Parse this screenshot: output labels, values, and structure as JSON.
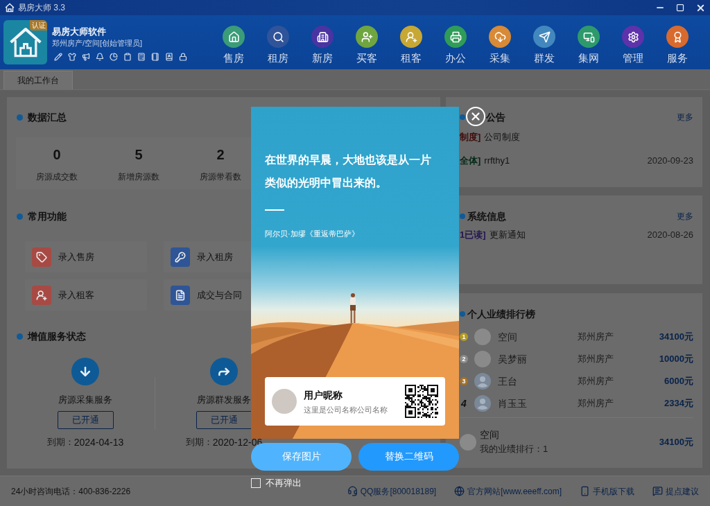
{
  "window": {
    "title": "易房大师 3.3"
  },
  "header": {
    "badge": "认证",
    "company": "易房大师软件",
    "account": "郑州房产/空间[创始管理员]",
    "nav": [
      {
        "label": "售房",
        "color": "#3a9c78"
      },
      {
        "label": "租房",
        "color": "#30549a"
      },
      {
        "label": "新房",
        "color": "#4a34a2"
      },
      {
        "label": "买客",
        "color": "#6fa640"
      },
      {
        "label": "租客",
        "color": "#c7a834"
      },
      {
        "label": "办公",
        "color": "#2f9c58"
      },
      {
        "label": "采集",
        "color": "#d88a36"
      },
      {
        "label": "群发",
        "color": "#4288be"
      },
      {
        "label": "集网",
        "color": "#2e9a6c"
      },
      {
        "label": "管理",
        "color": "#5e32aa"
      },
      {
        "label": "服务",
        "color": "#d96a2e"
      }
    ]
  },
  "tabs": [
    {
      "label": "我的工作台",
      "selected": true
    }
  ],
  "summary": {
    "title": "数据汇总",
    "stats": [
      {
        "value": "0",
        "label": "房源成交数"
      },
      {
        "value": "5",
        "label": "新增房源数"
      },
      {
        "value": "2",
        "label": "房源带看数"
      }
    ]
  },
  "shortcuts": {
    "title": "常用功能",
    "items": [
      {
        "label": "录入售房",
        "color": "#a84a44"
      },
      {
        "label": "录入租房",
        "color": "#2f5596"
      },
      {
        "label": "录入租客",
        "color": "#a84a44"
      },
      {
        "label": "成交与合同",
        "color": "#2f5596"
      }
    ]
  },
  "services": {
    "title": "增值服务状态",
    "items": [
      {
        "name": "房源采集服务",
        "status": "已开通",
        "expiry_label": "到期：",
        "expiry": "2024-04-13"
      },
      {
        "name": "房源群发服务",
        "status": "已开通",
        "expiry_label": "到期：",
        "expiry": "2020-12-06"
      }
    ]
  },
  "notices": {
    "title": "公告",
    "more": "更多",
    "items": [
      {
        "tag": "制度]",
        "color": "#3f0e0c",
        "title": "公司制度"
      },
      {
        "tag": "全体]",
        "color": "#052a18",
        "title": "rrfthy1",
        "date": "2020-09-23"
      }
    ]
  },
  "system_info": {
    "title": "系统信息",
    "more": "更多",
    "items": [
      {
        "tag": "1已读]",
        "color": "#241650",
        "title": "更新通知",
        "date": "2020-08-26"
      }
    ]
  },
  "ranking": {
    "title": "个人业绩排行榜",
    "rows": [
      {
        "kind": "medal",
        "rank": "1",
        "color": "#b39b22",
        "photo": true,
        "name": "空间",
        "company": "郑州房产",
        "amount": "34100元"
      },
      {
        "kind": "medal",
        "rank": "2",
        "color": "#8c8c8c",
        "photo": true,
        "name": "吴梦丽",
        "company": "郑州房产",
        "amount": "10000元"
      },
      {
        "kind": "medal",
        "rank": "3",
        "color": "#a4722c",
        "photo": false,
        "name": "王台",
        "company": "郑州房产",
        "amount": "6000元"
      },
      {
        "kind": "number",
        "rank": "4",
        "photo": false,
        "name": "肖玉玉",
        "company": "郑州房产",
        "amount": "2334元"
      }
    ],
    "mine": {
      "photo": true,
      "name": "空间",
      "rank_text": "我的业绩排行：1",
      "amount": "34100元"
    }
  },
  "footer": {
    "hotline": "24小时咨询电话：400-836-2226",
    "links": [
      "QQ服务[800018189]",
      "官方网站[www.eeeff.com]",
      "手机版下载",
      "提点建议"
    ]
  },
  "dialog": {
    "quote": "在世界的早晨，大地也该是从一片类似的光明中冒出来的。",
    "source": "阿尔贝·加缪《重返蒂巴萨》",
    "user_name": "用户昵称",
    "company": "这里是公司名称公司名称",
    "buttons": [
      {
        "label": "保存图片",
        "kind": "secondary"
      },
      {
        "label": "替换二维码",
        "kind": "primary"
      }
    ],
    "dont_show": {
      "label": "不再弹出",
      "checked": false
    }
  }
}
